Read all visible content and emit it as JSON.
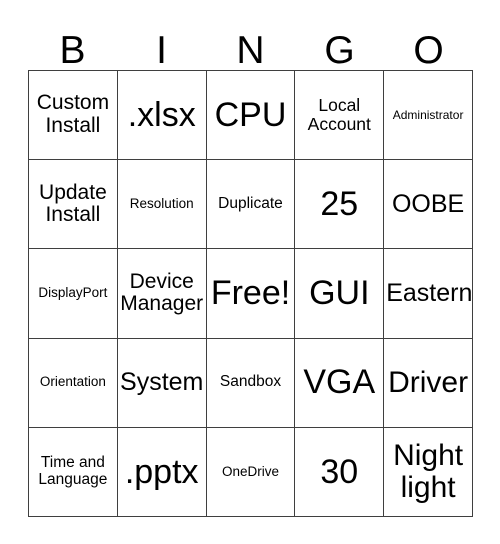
{
  "card": {
    "title": "BINGO",
    "header_letters": [
      "B",
      "I",
      "N",
      "G",
      "O"
    ],
    "free_space_label": "Free!",
    "colors": {
      "background": "#ffffff",
      "text": "#000000",
      "grid_line": "#3f3f3f"
    },
    "grid": {
      "rows": 5,
      "columns": 5,
      "cells": [
        [
          {
            "text": "Custom\nInstall",
            "size": "l"
          },
          {
            "text": ".xlsx",
            "size": "max"
          },
          {
            "text": "CPU",
            "size": "max"
          },
          {
            "text": "Local\nAccount",
            "size": "m"
          },
          {
            "text": "Administrator",
            "size": "xxs"
          }
        ],
        [
          {
            "text": "Update\nInstall",
            "size": "l"
          },
          {
            "text": "Resolution",
            "size": "xs"
          },
          {
            "text": "Duplicate",
            "size": "s"
          },
          {
            "text": "25",
            "size": "max"
          },
          {
            "text": "OOBE",
            "size": "xl"
          }
        ],
        [
          {
            "text": "DisplayPort",
            "size": "xs"
          },
          {
            "text": "Device\nManager",
            "size": "l"
          },
          {
            "text": "Free!",
            "size": "max"
          },
          {
            "text": "GUI",
            "size": "max"
          },
          {
            "text": "Eastern",
            "size": "xl"
          }
        ],
        [
          {
            "text": "Orientation",
            "size": "xs"
          },
          {
            "text": "System",
            "size": "xl"
          },
          {
            "text": "Sandbox",
            "size": "s"
          },
          {
            "text": "VGA",
            "size": "max"
          },
          {
            "text": "Driver",
            "size": "xxl"
          }
        ],
        [
          {
            "text": "Time and\nLanguage",
            "size": "s"
          },
          {
            "text": ".pptx",
            "size": "max"
          },
          {
            "text": "OneDrive",
            "size": "xs"
          },
          {
            "text": "30",
            "size": "max"
          },
          {
            "text": "Night\nlight",
            "size": "xxl"
          }
        ]
      ]
    }
  }
}
